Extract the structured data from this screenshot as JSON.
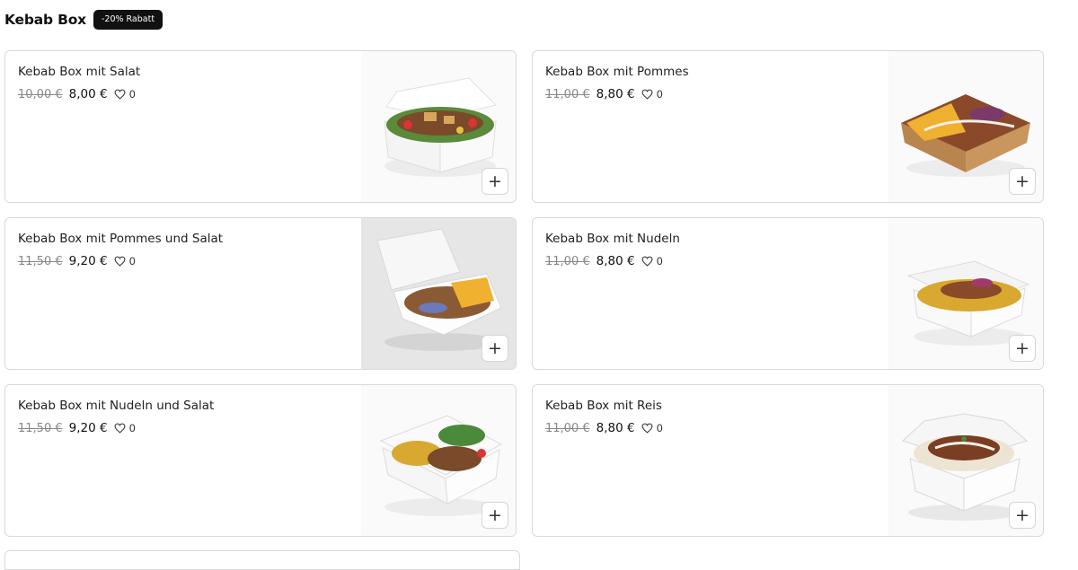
{
  "section": {
    "title": "Kebab Box",
    "badge": "-20% Rabatt"
  },
  "products": [
    {
      "name": "Kebab Box mit Salat",
      "old_price": "10,00 €",
      "price": "8,00 €",
      "likes": "0",
      "add_label": "+",
      "image_icon": "kebab-box-salad-image"
    },
    {
      "name": "Kebab Box mit Pommes",
      "old_price": "11,00 €",
      "price": "8,80 €",
      "likes": "0",
      "add_label": "+",
      "image_icon": "kebab-box-fries-image"
    },
    {
      "name": "Kebab Box mit Pommes und Salat",
      "old_price": "11,50 €",
      "price": "9,20 €",
      "likes": "0",
      "add_label": "+",
      "image_icon": "kebab-box-fries-salad-image"
    },
    {
      "name": "Kebab Box mit Nudeln",
      "old_price": "11,00 €",
      "price": "8,80 €",
      "likes": "0",
      "add_label": "+",
      "image_icon": "kebab-box-noodles-image"
    },
    {
      "name": "Kebab Box mit Nudeln und Salat",
      "old_price": "11,50 €",
      "price": "9,20 €",
      "likes": "0",
      "add_label": "+",
      "image_icon": "kebab-box-noodles-salad-image"
    },
    {
      "name": "Kebab Box mit Reis",
      "old_price": "11,00 €",
      "price": "8,80 €",
      "likes": "0",
      "add_label": "+",
      "image_icon": "kebab-box-rice-image"
    }
  ],
  "colors": {
    "badge_bg": "#111111",
    "card_border": "#d9d9d9",
    "old_price": "#888888"
  }
}
